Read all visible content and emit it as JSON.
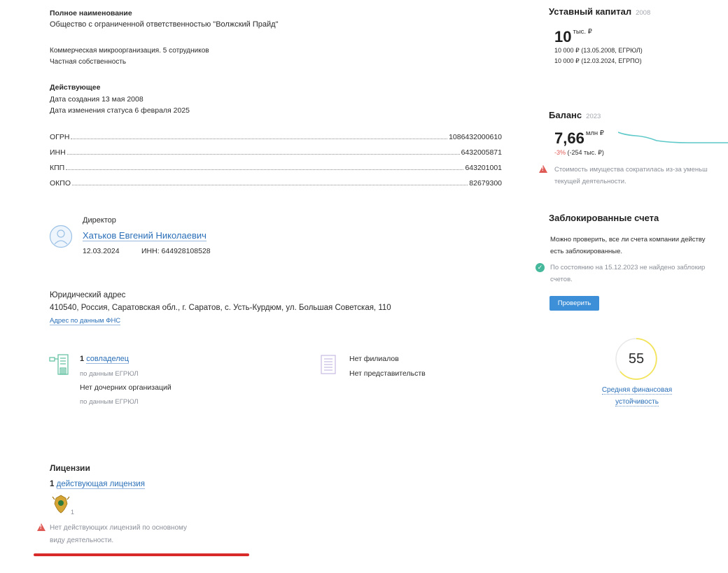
{
  "company": {
    "full_name_label": "Полное наименование",
    "full_name": "Общество с ограниченной ответственностью \"Волжский Прайд\"",
    "category": "Коммерческая микроорганизация. 5 сотрудников",
    "ownership": "Частная собственность",
    "status_label": "Действующее",
    "created": "Дата создания 13 мая 2008",
    "status_changed": "Дата изменения статуса 6 февраля 2025"
  },
  "codes": [
    {
      "label": "ОГРН",
      "value": "1086432000610"
    },
    {
      "label": "ИНН",
      "value": "6432005871"
    },
    {
      "label": "КПП",
      "value": "643201001"
    },
    {
      "label": "ОКПО",
      "value": "82679300"
    }
  ],
  "director": {
    "role": "Директор",
    "name": "Хатьков Евгений Николаевич",
    "date": "12.03.2024",
    "inn": "ИНН: 644928108528"
  },
  "address": {
    "label": "Юридический адрес",
    "value": "410540, Россия, Саратовская обл., г. Саратов, с. Усть-Курдюм, ул. Большая Советская, 110",
    "link": "Адрес по данным ФНС"
  },
  "owners": {
    "count": "1",
    "link": "совладелец",
    "source1": "по данным ЕГРЮЛ",
    "subsidiaries": "Нет дочерних организаций",
    "source2": "по данным ЕГРЮЛ"
  },
  "branches": {
    "line1": "Нет филиалов",
    "line2": "Нет представительств"
  },
  "licenses": {
    "title": "Лицензии",
    "count": "1",
    "link": "действующая лицензия",
    "emblem_count": "1",
    "warning_line1": "Нет действующих лицензий по основному",
    "warning_line2": "виду деятельности."
  },
  "capital": {
    "title": "Уставный капитал",
    "year": "2008",
    "value": "10",
    "unit": "тыс. ₽",
    "detail1": "10 000 ₽ (13.05.2008, ЕГРЮЛ)",
    "detail2": "10 000 ₽ (12.03.2024, ЕГРПО)"
  },
  "balance": {
    "title": "Баланс",
    "year": "2023",
    "value": "7,66",
    "unit": "млн ₽",
    "change_pct": "-3%",
    "change_abs": "(-254 тыс. ₽)",
    "warning_line1": "Стоимость имущества сократилась из-за уменьш",
    "warning_line2": "текущей деятельности.",
    "sparkline_color": "#5cc8c8"
  },
  "blocked": {
    "title": "Заблокированные счета",
    "desc1": "Можно проверить, все ли счета компании действу",
    "desc2": "есть заблокированные.",
    "status1": "По состоянию на 15.12.2023 не найдено заблокир",
    "status2": "счетов.",
    "button": "Проверить"
  },
  "stability": {
    "score": "55",
    "label1": "Средняя финансовая",
    "label2": "устойчивость",
    "ring_color": "#f3e45a"
  },
  "colors": {
    "link": "#2a6fb8",
    "warning": "#e05a55",
    "ok": "#46b89b",
    "button": "#3d8fd8",
    "red_underline": "#d92a2a"
  }
}
